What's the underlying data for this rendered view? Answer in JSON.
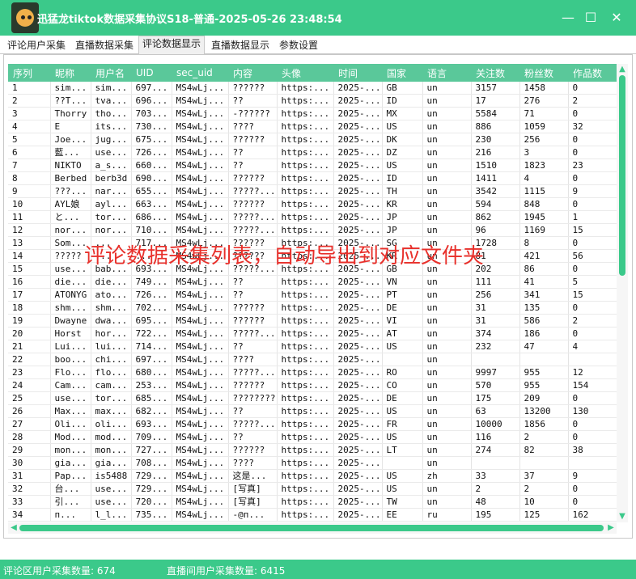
{
  "window": {
    "title": "迅猛龙tiktok数据采集协议S18-普通-2025-05-26 23:48:54",
    "minimize_glyph": "—",
    "maximize_glyph": "☐",
    "close_glyph": "✕"
  },
  "tabs": [
    {
      "label": "评论用户采集",
      "active": false
    },
    {
      "label": "直播数据采集",
      "active": false
    },
    {
      "label": "评论数据显示",
      "active": true
    },
    {
      "label": "直播数据显示",
      "active": false
    },
    {
      "label": "参数设置",
      "active": false
    }
  ],
  "table": {
    "columns": [
      "序列",
      "昵称",
      "用户名",
      "UID",
      "sec_uid",
      "内容",
      "头像",
      "时间",
      "国家",
      "语言",
      "关注数",
      "粉丝数",
      "作品数"
    ],
    "rows": [
      [
        "1",
        "sim...",
        "sim...",
        "697...",
        "MS4wLj...",
        "??????",
        "https:...",
        "2025-...",
        "GB",
        "un",
        "3157",
        "1458",
        "0"
      ],
      [
        "2",
        "??T...",
        "tva...",
        "696...",
        "MS4wLj...",
        "??",
        "https:...",
        "2025-...",
        "ID",
        "un",
        "17",
        "276",
        "2"
      ],
      [
        "3",
        "Thorry",
        "tho...",
        "703...",
        "MS4wLj...",
        "-??????",
        "https:...",
        "2025-...",
        "MX",
        "un",
        "5584",
        "71",
        "0"
      ],
      [
        "4",
        "E",
        "its...",
        "730...",
        "MS4wLj...",
        "????",
        "https:...",
        "2025-...",
        "US",
        "un",
        "886",
        "1059",
        "32"
      ],
      [
        "5",
        "Joe...",
        "jug...",
        "675...",
        "MS4wLj...",
        "??????",
        "https:...",
        "2025-...",
        "DK",
        "un",
        "230",
        "256",
        "0"
      ],
      [
        "6",
        "藍...",
        "use...",
        "726...",
        "MS4wLj...",
        "??",
        "https:...",
        "2025-...",
        "DZ",
        "un",
        "216",
        "3",
        "0"
      ],
      [
        "7",
        "NIKTO",
        "a_s...",
        "660...",
        "MS4wLj...",
        "??",
        "https:...",
        "2025-...",
        "US",
        "un",
        "1510",
        "1823",
        "23"
      ],
      [
        "8",
        "Berbed",
        "berb3d",
        "690...",
        "MS4wLj...",
        "??????",
        "https:...",
        "2025-...",
        "ID",
        "un",
        "1411",
        "4",
        "0"
      ],
      [
        "9",
        "???...",
        "nar...",
        "655...",
        "MS4wLj...",
        "?????...",
        "https:...",
        "2025-...",
        "TH",
        "un",
        "3542",
        "1115",
        "9"
      ],
      [
        "10",
        "AYL娘",
        "ayl...",
        "663...",
        "MS4wLj...",
        "??????",
        "https:...",
        "2025-...",
        "KR",
        "un",
        "594",
        "848",
        "0"
      ],
      [
        "11",
        "と...",
        "tor...",
        "686...",
        "MS4wLj...",
        "?????...",
        "https:...",
        "2025-...",
        "JP",
        "un",
        "862",
        "1945",
        "1"
      ],
      [
        "12",
        "nor...",
        "nor...",
        "710...",
        "MS4wLj...",
        "?????...",
        "https:...",
        "2025-...",
        "JP",
        "un",
        "96",
        "1169",
        "15"
      ],
      [
        "13",
        "Som...",
        "...",
        "717...",
        "MS4wLj...",
        "??????",
        "https:...",
        "2025-...",
        "SG",
        "un",
        "1728",
        "8",
        "0"
      ],
      [
        "14",
        "?????",
        "...",
        "...",
        "MS4wLj...",
        "??????",
        "https:...",
        "2025-...",
        "KR",
        "un",
        "81",
        "421",
        "56"
      ],
      [
        "15",
        "use...",
        "bab...",
        "693...",
        "MS4wLj...",
        "?????...",
        "https:...",
        "2025-...",
        "GB",
        "un",
        "202",
        "86",
        "0"
      ],
      [
        "16",
        "die...",
        "die...",
        "749...",
        "MS4wLj...",
        "??",
        "https:...",
        "2025-...",
        "VN",
        "un",
        "111",
        "41",
        "5"
      ],
      [
        "17",
        "ATONYG",
        "ato...",
        "726...",
        "MS4wLj...",
        "??",
        "https:...",
        "2025-...",
        "PT",
        "un",
        "256",
        "341",
        "15"
      ],
      [
        "18",
        "shm...",
        "shm...",
        "702...",
        "MS4wLj...",
        "??????",
        "https:...",
        "2025-...",
        "DE",
        "un",
        "31",
        "135",
        "0"
      ],
      [
        "19",
        "Dwayne",
        "dwa...",
        "695...",
        "MS4wLj...",
        "??????",
        "https:...",
        "2025-...",
        "VI",
        "un",
        "31",
        "586",
        "2"
      ],
      [
        "20",
        "Horst",
        "hor...",
        "722...",
        "MS4wLj...",
        "?????...",
        "https:...",
        "2025-...",
        "AT",
        "un",
        "374",
        "186",
        "0"
      ],
      [
        "21",
        "Lui...",
        "lui...",
        "714...",
        "MS4wLj...",
        "??",
        "https:...",
        "2025-...",
        "US",
        "un",
        "232",
        "47",
        "4"
      ],
      [
        "22",
        "boo...",
        "chi...",
        "697...",
        "MS4wLj...",
        "????",
        "https:...",
        "2025-...",
        "",
        "un",
        "",
        "",
        ""
      ],
      [
        "23",
        "Flo...",
        "flo...",
        "680...",
        "MS4wLj...",
        "?????...",
        "https:...",
        "2025-...",
        "RO",
        "un",
        "9997",
        "955",
        "12"
      ],
      [
        "24",
        "Cam...",
        "cam...",
        "253...",
        "MS4wLj...",
        "??????",
        "https:...",
        "2025-...",
        "CO",
        "un",
        "570",
        "955",
        "154"
      ],
      [
        "25",
        "use...",
        "tor...",
        "685...",
        "MS4wLj...",
        "????????",
        "https:...",
        "2025-...",
        "DE",
        "un",
        "175",
        "209",
        "0"
      ],
      [
        "26",
        "Max...",
        "max...",
        "682...",
        "MS4wLj...",
        "??",
        "https:...",
        "2025-...",
        "US",
        "un",
        "63",
        "13200",
        "130"
      ],
      [
        "27",
        "Oli...",
        "oli...",
        "693...",
        "MS4wLj...",
        "?????...",
        "https:...",
        "2025-...",
        "FR",
        "un",
        "10000",
        "1856",
        "0"
      ],
      [
        "28",
        "Mod...",
        "mod...",
        "709...",
        "MS4wLj...",
        "??",
        "https:...",
        "2025-...",
        "US",
        "un",
        "116",
        "2",
        "0"
      ],
      [
        "29",
        "mon...",
        "mon...",
        "727...",
        "MS4wLj...",
        "??????",
        "https:...",
        "2025-...",
        "LT",
        "un",
        "274",
        "82",
        "38"
      ],
      [
        "30",
        "gia...",
        "gia...",
        "708...",
        "MS4wLj...",
        "????",
        "https:...",
        "2025-...",
        "",
        "un",
        "",
        "",
        ""
      ],
      [
        "31",
        "Pap...",
        "is5488",
        "729...",
        "MS4wLj...",
        "这是...",
        "https:...",
        "2025-...",
        "US",
        "zh",
        "33",
        "37",
        "9"
      ],
      [
        "32",
        "台...",
        "use...",
        "729...",
        "MS4wLj...",
        "[写真]",
        "https:...",
        "2025-...",
        "US",
        "un",
        "2",
        "2",
        "0"
      ],
      [
        "33",
        "引...",
        "use...",
        "720...",
        "MS4wLj...",
        "[写真]",
        "https:...",
        "2025-...",
        "TW",
        "un",
        "48",
        "10",
        "0"
      ],
      [
        "34",
        "п...",
        "l_l...",
        "735...",
        "MS4wLj...",
        "-@п...",
        "https:...",
        "2025-...",
        "EE",
        "ru",
        "195",
        "125",
        "162"
      ]
    ]
  },
  "overlay_caption": "评论数据采集列表，自动导出到对应文件夹",
  "scroll_arrows": {
    "up": "▲",
    "down": "▼",
    "left": "◀",
    "right": "▶"
  },
  "status": {
    "comment_users": "评论区用户采集数量: 674",
    "live_users": "直播间用户采集数量: 6415"
  },
  "colors": {
    "accent": "#3bc98a",
    "header": "#5ac89a",
    "overlay_text": "#e8302b"
  }
}
